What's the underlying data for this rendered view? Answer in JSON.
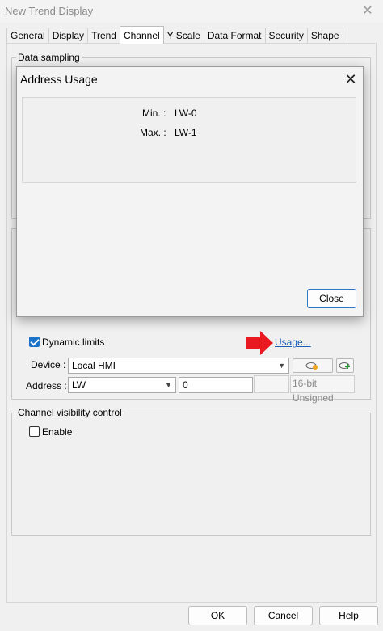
{
  "window": {
    "title": "New Trend Display",
    "close_glyph": "✕"
  },
  "tabs": [
    "General",
    "Display",
    "Trend",
    "Channel",
    "Y Scale",
    "Data Format",
    "Security",
    "Shape"
  ],
  "active_tab": "Channel",
  "data_sampling": {
    "label": "Data sampling"
  },
  "address_usage_dialog": {
    "title": "Address Usage",
    "close_glyph": "✕",
    "min_label": "Min. :",
    "min_value": "LW-0",
    "max_label": "Max. :",
    "max_value": "LW-1",
    "close_button": "Close"
  },
  "dynamic_limits": {
    "label": "Dynamic limits",
    "checked": true
  },
  "usage_link": "Usage...",
  "device": {
    "label": "Device :",
    "value": "Local HMI"
  },
  "address": {
    "label": "Address :",
    "type": "LW",
    "value": "0",
    "format": "16-bit Unsigned"
  },
  "channel_visibility": {
    "label": "Channel visibility control",
    "enable_label": "Enable",
    "checked": false
  },
  "buttons": {
    "ok": "OK",
    "cancel": "Cancel",
    "help": "Help"
  },
  "colors": {
    "accent": "#1a73c8",
    "arrow": "#e8191f",
    "link": "#1a5fb4"
  },
  "icons": [
    "close-icon",
    "red-arrow-icon",
    "chevron-down-icon",
    "check-icon"
  ]
}
